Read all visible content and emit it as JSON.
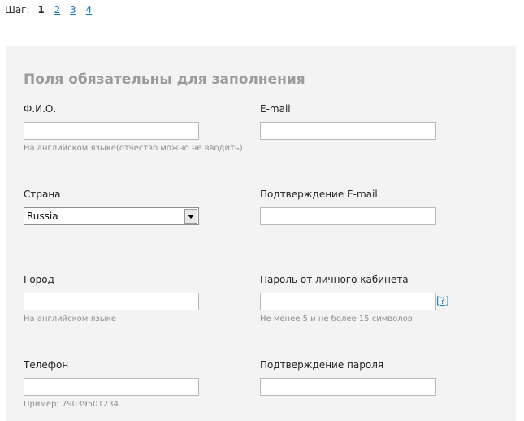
{
  "steps": {
    "label": "Шаг:",
    "current": "1",
    "links": [
      "2",
      "3",
      "4"
    ]
  },
  "form": {
    "title": "Поля обязательны для заполнения",
    "fio": {
      "label": "Ф.И.О.",
      "value": "",
      "hint": "На английском языке(отчество можно не вводить)"
    },
    "email": {
      "label": "E-mail",
      "value": ""
    },
    "country": {
      "label": "Страна",
      "selected": "Russia"
    },
    "email_confirm": {
      "label": "Подтверждение E-mail",
      "value": ""
    },
    "city": {
      "label": "Город",
      "value": "",
      "hint": "На английском языке"
    },
    "password": {
      "label": "Пароль от личного кабинета",
      "value": "",
      "hint": "Не менее 5 и не более 15 символов",
      "help": "[?]"
    },
    "phone": {
      "label": "Телефон",
      "value": "",
      "hint": "Пример: 79039501234"
    },
    "password_confirm": {
      "label": "Подтверждение пароля",
      "value": ""
    }
  },
  "icons": {
    "select_arrow": "chevron-down-icon"
  }
}
